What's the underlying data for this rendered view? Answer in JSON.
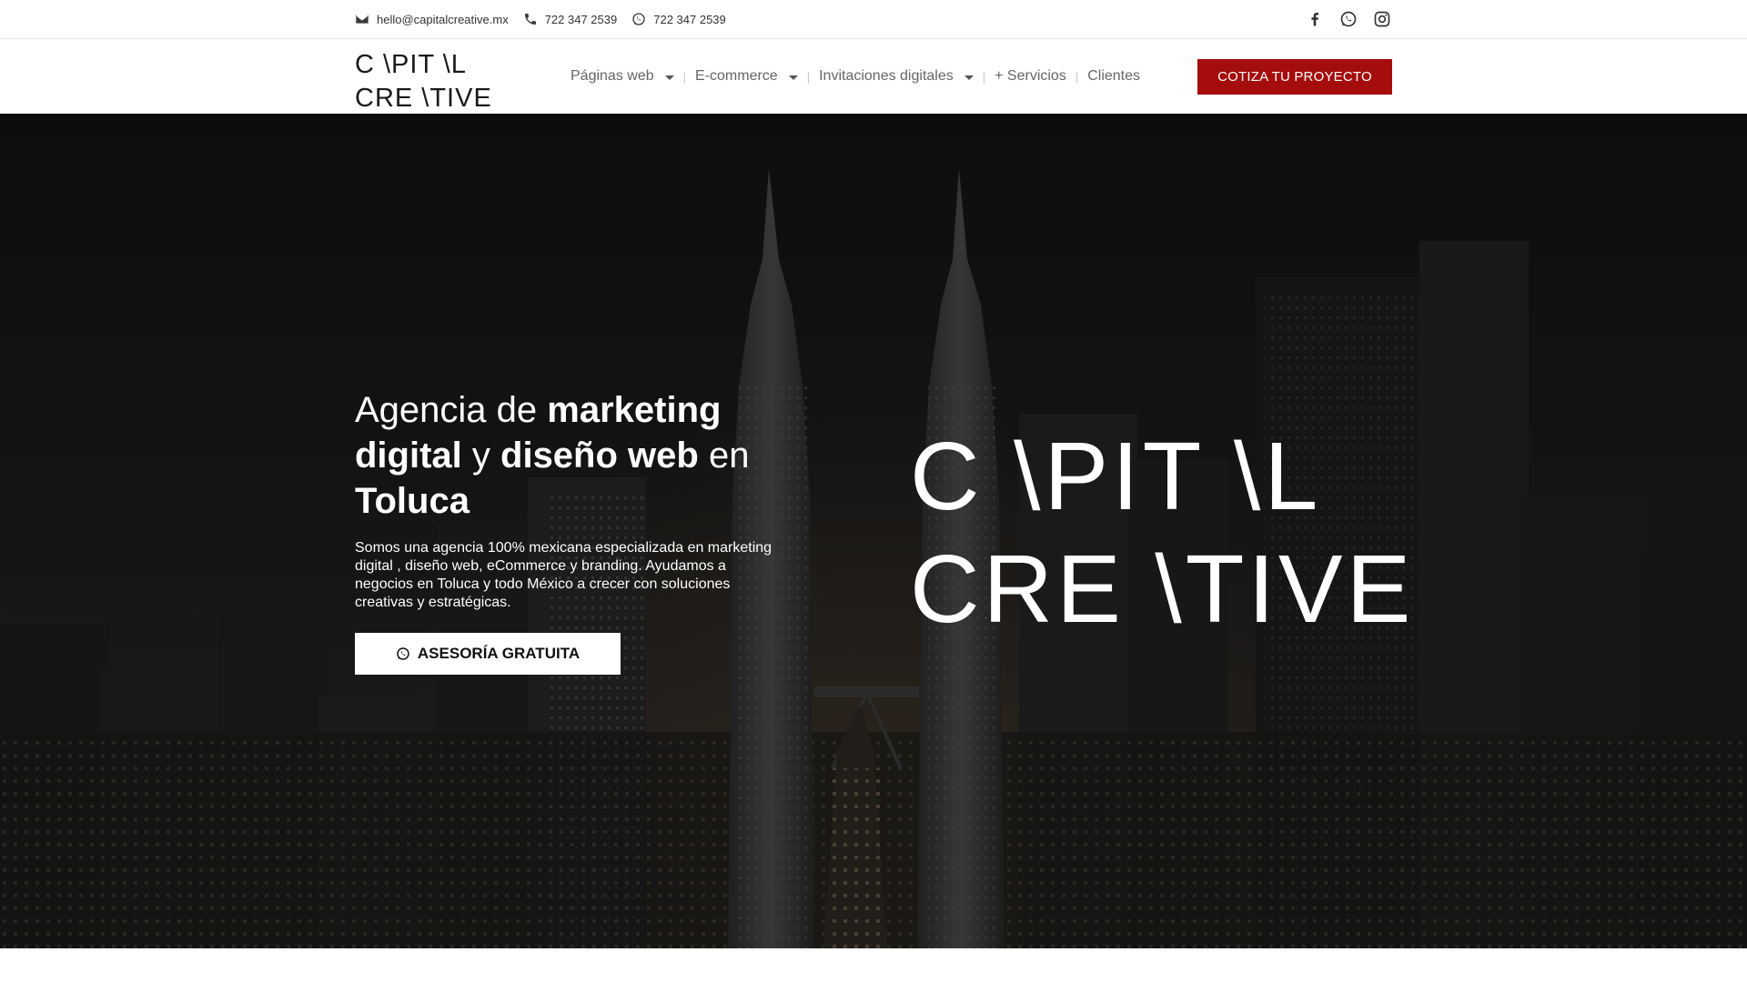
{
  "topbar": {
    "email": "hello@capitalcreative.mx",
    "phone": "722 347 2539",
    "whatsapp": "722 347 2539",
    "social": [
      "facebook-icon",
      "whatsapp-icon",
      "instagram-icon"
    ]
  },
  "header": {
    "logo_line1": "C \\PIT \\L",
    "logo_line2": "CRE \\TIVE",
    "nav": [
      {
        "label": "Páginas web",
        "dropdown": true
      },
      {
        "label": "E-commerce",
        "dropdown": true
      },
      {
        "label": "Invitaciones digitales",
        "dropdown": true
      },
      {
        "label": "+ Servicios",
        "dropdown": false
      },
      {
        "label": "Clientes",
        "dropdown": false
      }
    ],
    "cta_label": "COTIZA TU PROYECTO"
  },
  "hero": {
    "headline": {
      "p1": "Agencia de ",
      "b1": "marketing digital",
      "p2": " y ",
      "b2": "diseño web",
      "p3": " en ",
      "b3": "Toluca"
    },
    "lead": "Somos una agencia 100% mexicana especializada en marketing digital , diseño web, eCommerce y branding. Ayudamos a negocios en Toluca y todo México a crecer con soluciones creativas y estratégicas.",
    "button_label": "ASESORÍA GRATUITA",
    "big_logo_line1": "C \\PIT \\L",
    "big_logo_line2": "CRE \\TIVE"
  },
  "colors": {
    "accent": "#a50d0d",
    "hero_bg": "#1b1b1b",
    "text_dark": "#333333"
  }
}
